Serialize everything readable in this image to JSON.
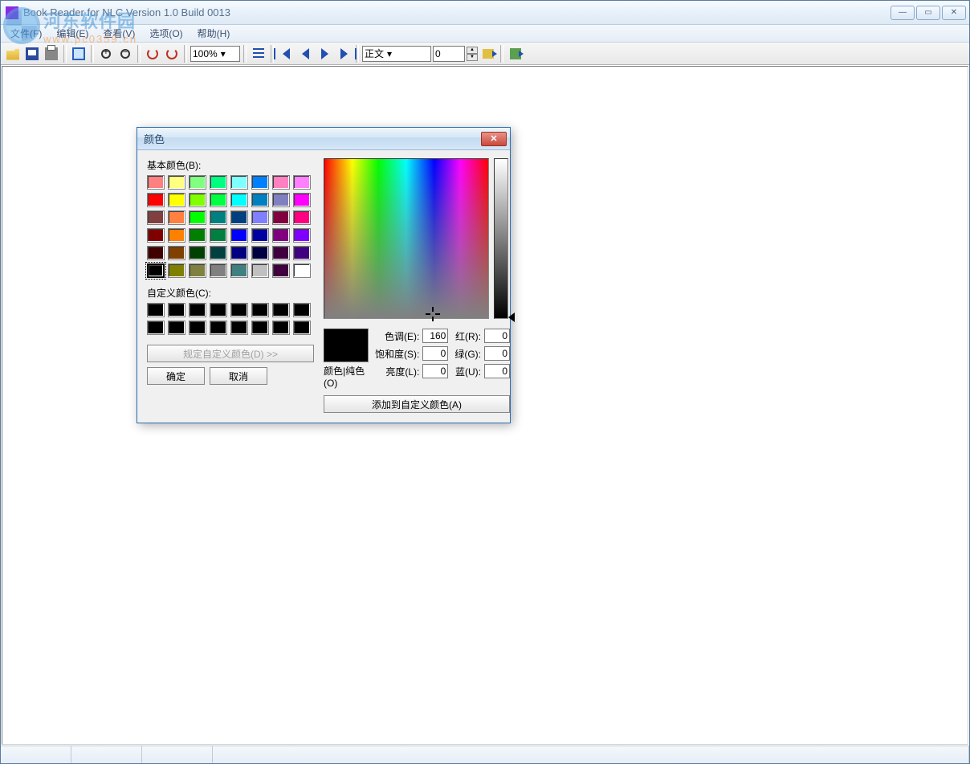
{
  "window": {
    "title": "Book Reader  for NLC Version 1.0 Build 0013"
  },
  "watermark": {
    "line1": "河东软件园",
    "line2": "www.pc0359.cn"
  },
  "menu": {
    "file": "文件(F)",
    "edit": "编辑(E)",
    "view": "查看(V)",
    "options": "选项(O)",
    "help": "帮助(H)"
  },
  "toolbar": {
    "zoom_value": "100%",
    "section_value": "正文",
    "page_value": "0"
  },
  "color_dialog": {
    "title": "颜色",
    "basic_label": "基本颜色(B):",
    "custom_label": "自定义颜色(C):",
    "define_btn": "规定自定义颜色(D) >>",
    "ok": "确定",
    "cancel": "取消",
    "solid_label": "颜色|纯色(O)",
    "hue_label": "色调(E):",
    "sat_label": "饱和度(S):",
    "lum_label": "亮度(L):",
    "red_label": "红(R):",
    "green_label": "绿(G):",
    "blue_label": "蓝(U):",
    "hue": "160",
    "sat": "0",
    "lum": "0",
    "red": "0",
    "green": "0",
    "blue": "0",
    "add_btn": "添加到自定义颜色(A)"
  },
  "basic_colors": [
    "#ff8080",
    "#ffff80",
    "#80ff80",
    "#00ff80",
    "#80ffff",
    "#0080ff",
    "#ff80c0",
    "#ff80ff",
    "#ff0000",
    "#ffff00",
    "#80ff00",
    "#00ff40",
    "#00ffff",
    "#0080c0",
    "#8080c0",
    "#ff00ff",
    "#804040",
    "#ff8040",
    "#00ff00",
    "#008080",
    "#004080",
    "#8080ff",
    "#800040",
    "#ff0080",
    "#800000",
    "#ff8000",
    "#008000",
    "#008040",
    "#0000ff",
    "#0000a0",
    "#800080",
    "#8000ff",
    "#400000",
    "#804000",
    "#004000",
    "#004040",
    "#000080",
    "#000040",
    "#400040",
    "#400080",
    "#000000",
    "#808000",
    "#808040",
    "#808080",
    "#408080",
    "#c0c0c0",
    "#400040",
    "#ffffff"
  ],
  "custom_colors": [
    "#000000",
    "#000000",
    "#000000",
    "#000000",
    "#000000",
    "#000000",
    "#000000",
    "#000000",
    "#000000",
    "#000000",
    "#000000",
    "#000000",
    "#000000",
    "#000000",
    "#000000",
    "#000000"
  ]
}
